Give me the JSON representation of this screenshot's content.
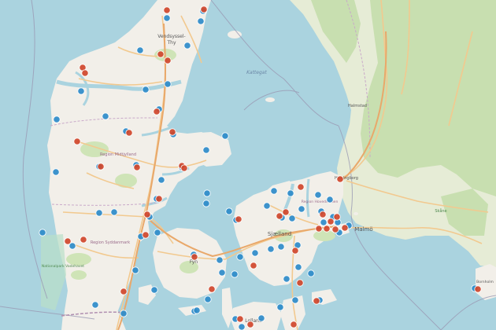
{
  "map": {
    "colors": {
      "water": "#aad3df",
      "land": "#f2efe9",
      "forest": "#c8dfb0",
      "road": "#f2c98f",
      "road_major": "#e9a86a",
      "border": "#9a9ab4",
      "marker_blue": "#2e8bc9",
      "marker_red": "#d0462b"
    },
    "labels": {
      "vendsyssel": "Vendsyssel-",
      "thy": "Thy",
      "kattegat": "Kattegat",
      "sjaelland": "Sjælland",
      "fyn": "Fyn",
      "lolland": "Lolland",
      "malmo": "Malmö",
      "halmstad": "Halmstad",
      "helsingborg": "Helsingborg",
      "region_midtjylland": "Region Midtjylland",
      "region_syddanmark": "Region Syddanmark",
      "nationalpark": "Nationalpark Vadehavet",
      "region_hovedstaden": "Region Hovedstaden",
      "skane": "Skåne",
      "bornholm": "Bornholm"
    },
    "marker_legend": {
      "blue": "blue-station-marker",
      "red": "red-station-marker"
    }
  }
}
